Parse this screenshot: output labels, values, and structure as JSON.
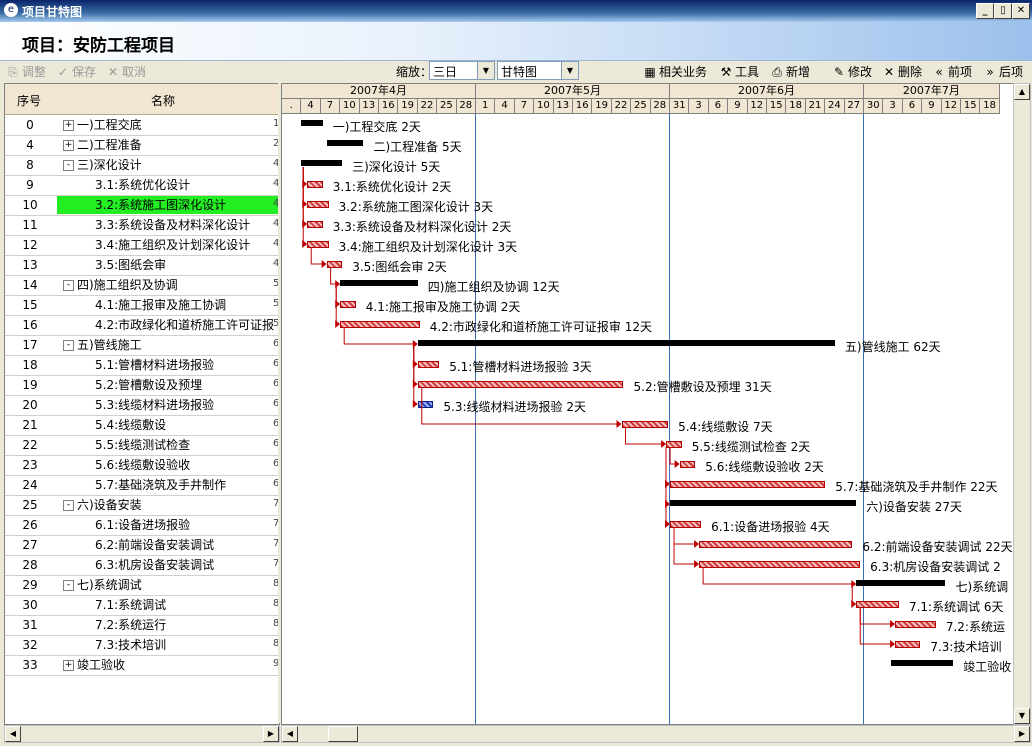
{
  "window": {
    "title": "项目甘特图",
    "minimize": "_",
    "restore": "▯",
    "close": "✕"
  },
  "header": {
    "project_title": "项目：安防工程项目"
  },
  "toolbar": {
    "adjust": "调整",
    "save": "保存",
    "cancel": "取消",
    "zoom_label": "缩放：",
    "zoom_value": "三日",
    "view_value": "甘特图",
    "related": "相关业务",
    "tools": "工具",
    "add": "新增",
    "edit": "修改",
    "delete": "删除",
    "prev": "前项",
    "next": "后项"
  },
  "columns": {
    "seq": "序号",
    "name": "名称"
  },
  "rows": [
    {
      "no": "0",
      "name": "一)工程交底",
      "expander": "+",
      "level": 0,
      "extra": "1"
    },
    {
      "no": "4",
      "name": "二)工程准备",
      "expander": "+",
      "level": 0,
      "extra": "2"
    },
    {
      "no": "8",
      "name": "三)深化设计",
      "expander": "-",
      "level": 0,
      "extra": "4"
    },
    {
      "no": "9",
      "name": "3.1:系统优化设计",
      "expander": "",
      "level": 1,
      "extra": "4"
    },
    {
      "no": "10",
      "name": "3.2:系统施工图深化设计",
      "expander": "",
      "level": 1,
      "extra": "4",
      "selected": true
    },
    {
      "no": "11",
      "name": "3.3:系统设备及材料深化设计",
      "expander": "",
      "level": 1,
      "extra": "4"
    },
    {
      "no": "12",
      "name": "3.4:施工组织及计划深化设计",
      "expander": "",
      "level": 1,
      "extra": "4"
    },
    {
      "no": "13",
      "name": "3.5:图纸会审",
      "expander": "",
      "level": 1,
      "extra": "4"
    },
    {
      "no": "14",
      "name": "四)施工组织及协调",
      "expander": "-",
      "level": 0,
      "extra": "5"
    },
    {
      "no": "15",
      "name": "4.1:施工报审及施工协调",
      "expander": "",
      "level": 1,
      "extra": "5"
    },
    {
      "no": "16",
      "name": "4.2:市政绿化和道桥施工许可证报",
      "expander": "",
      "level": 1,
      "extra": "5"
    },
    {
      "no": "17",
      "name": "五)管线施工",
      "expander": "-",
      "level": 0,
      "extra": "6"
    },
    {
      "no": "18",
      "name": "5.1:管槽材料进场报验",
      "expander": "",
      "level": 1,
      "extra": "6"
    },
    {
      "no": "19",
      "name": "5.2:管槽敷设及预埋",
      "expander": "",
      "level": 1,
      "extra": "6"
    },
    {
      "no": "20",
      "name": "5.3:线缆材料进场报验",
      "expander": "",
      "level": 1,
      "extra": "6"
    },
    {
      "no": "21",
      "name": "5.4:线缆敷设",
      "expander": "",
      "level": 1,
      "extra": "6"
    },
    {
      "no": "22",
      "name": "5.5:线缆测试检查",
      "expander": "",
      "level": 1,
      "extra": "6"
    },
    {
      "no": "23",
      "name": "5.6:线缆敷设验收",
      "expander": "",
      "level": 1,
      "extra": "6"
    },
    {
      "no": "24",
      "name": "5.7:基础浇筑及手井制作",
      "expander": "",
      "level": 1,
      "extra": "6"
    },
    {
      "no": "25",
      "name": "六)设备安装",
      "expander": "-",
      "level": 0,
      "extra": "7"
    },
    {
      "no": "26",
      "name": "6.1:设备进场报验",
      "expander": "",
      "level": 1,
      "extra": "7"
    },
    {
      "no": "27",
      "name": "6.2:前端设备安装调试",
      "expander": "",
      "level": 1,
      "extra": "7"
    },
    {
      "no": "28",
      "name": "6.3:机房设备安装调试",
      "expander": "",
      "level": 1,
      "extra": "7"
    },
    {
      "no": "29",
      "name": "七)系统调试",
      "expander": "-",
      "level": 0,
      "extra": "8"
    },
    {
      "no": "30",
      "name": "7.1:系统调试",
      "expander": "",
      "level": 1,
      "extra": "8"
    },
    {
      "no": "31",
      "name": "7.2:系统运行",
      "expander": "",
      "level": 1,
      "extra": "8"
    },
    {
      "no": "32",
      "name": "7.3:技术培训",
      "expander": "",
      "level": 1,
      "extra": "8"
    },
    {
      "no": "33",
      "name": "竣工验收",
      "expander": "+",
      "level": 0,
      "extra": "9"
    }
  ],
  "timeline": {
    "months": [
      "2007年4月",
      "2007年5月",
      "2007年6月",
      "2007年7月"
    ],
    "days": [
      ".",
      "4",
      "7",
      "10",
      "13",
      "16",
      "19",
      "22",
      "25",
      "28",
      "1",
      "4",
      "7",
      "10",
      "13",
      "16",
      "19",
      "22",
      "25",
      "28",
      "31",
      "3",
      "6",
      "9",
      "12",
      "15",
      "18",
      "21",
      "24",
      "27",
      "30",
      "3",
      "6",
      "9",
      "12",
      "15",
      "18"
    ]
  },
  "bars": [
    {
      "row": 0,
      "type": "summary",
      "start": 1,
      "dur": 1.1,
      "label": "一)工程交底 2天"
    },
    {
      "row": 1,
      "type": "summary",
      "start": 2.3,
      "dur": 1.9,
      "label": "二)工程准备 5天"
    },
    {
      "row": 2,
      "type": "summary",
      "start": 1,
      "dur": 2.1,
      "label": "三)深化设计 5天"
    },
    {
      "row": 3,
      "type": "task",
      "start": 1.3,
      "dur": 0.7,
      "label": "3.1:系统优化设计 2天"
    },
    {
      "row": 4,
      "type": "task",
      "start": 1.3,
      "dur": 1.0,
      "label": "3.2:系统施工图深化设计 3天"
    },
    {
      "row": 5,
      "type": "task",
      "start": 1.3,
      "dur": 0.7,
      "label": "3.3:系统设备及材料深化设计 2天"
    },
    {
      "row": 6,
      "type": "task",
      "start": 1.3,
      "dur": 1.0,
      "label": "3.4:施工组织及计划深化设计 3天"
    },
    {
      "row": 7,
      "type": "task",
      "start": 2.3,
      "dur": 0.7,
      "label": "3.5:图纸会审 2天"
    },
    {
      "row": 8,
      "type": "summary",
      "start": 3.0,
      "dur": 4.0,
      "label": "四)施工组织及协调 12天"
    },
    {
      "row": 9,
      "type": "task",
      "start": 3.0,
      "dur": 0.7,
      "label": "4.1:施工报审及施工协调 2天"
    },
    {
      "row": 10,
      "type": "task",
      "start": 3.0,
      "dur": 4.0,
      "label": "4.2:市政绿化和道桥施工许可证报审 12天"
    },
    {
      "row": 11,
      "type": "summary",
      "start": 7.0,
      "dur": 21.5,
      "label": "五)管线施工 62天"
    },
    {
      "row": 12,
      "type": "task",
      "start": 7.0,
      "dur": 1.0,
      "label": "5.1:管槽材料进场报验 3天"
    },
    {
      "row": 13,
      "type": "task",
      "start": 7.0,
      "dur": 10.5,
      "label": "5.2:管槽敷设及预埋 31天"
    },
    {
      "row": 14,
      "type": "blue",
      "start": 7.0,
      "dur": 0.7,
      "label": "5.3:线缆材料进场报验 2天"
    },
    {
      "row": 15,
      "type": "task",
      "start": 17.5,
      "dur": 2.3,
      "label": "5.4:线缆敷设 7天"
    },
    {
      "row": 16,
      "type": "task",
      "start": 19.8,
      "dur": 0.7,
      "label": "5.5:线缆测试检查 2天"
    },
    {
      "row": 17,
      "type": "task",
      "start": 20.5,
      "dur": 0.7,
      "label": "5.6:线缆敷设验收 2天"
    },
    {
      "row": 18,
      "type": "task",
      "start": 20.0,
      "dur": 7.9,
      "label": "5.7:基础浇筑及手井制作 22天"
    },
    {
      "row": 19,
      "type": "summary",
      "start": 20.0,
      "dur": 9.6,
      "label": "六)设备安装 27天"
    },
    {
      "row": 20,
      "type": "task",
      "start": 20.0,
      "dur": 1.5,
      "label": "6.1:设备进场报验 4天"
    },
    {
      "row": 21,
      "type": "task",
      "start": 21.5,
      "dur": 7.8,
      "label": "6.2:前端设备安装调试 22天"
    },
    {
      "row": 22,
      "type": "task",
      "start": 21.5,
      "dur": 8.2,
      "label": "6.3:机房设备安装调试 2"
    },
    {
      "row": 23,
      "type": "summary",
      "start": 29.6,
      "dur": 4.6,
      "label": "七)系统调"
    },
    {
      "row": 24,
      "type": "task",
      "start": 29.6,
      "dur": 2.1,
      "label": "7.1:系统调试 6天"
    },
    {
      "row": 25,
      "type": "task",
      "start": 31.6,
      "dur": 2.0,
      "label": "7.2:系统运"
    },
    {
      "row": 26,
      "type": "task",
      "start": 31.6,
      "dur": 1.2,
      "label": "7.3:技术培训"
    },
    {
      "row": 27,
      "type": "summary",
      "start": 31.4,
      "dur": 3.2,
      "label": "竣工验收"
    }
  ],
  "connectors": [
    [
      2,
      3
    ],
    [
      2,
      4
    ],
    [
      2,
      5
    ],
    [
      2,
      6
    ],
    [
      6,
      7
    ],
    [
      7,
      8
    ],
    [
      8,
      9
    ],
    [
      8,
      10
    ],
    [
      10,
      11
    ],
    [
      11,
      12
    ],
    [
      11,
      13
    ],
    [
      11,
      14
    ],
    [
      13,
      15
    ],
    [
      15,
      16
    ],
    [
      16,
      17
    ],
    [
      16,
      18
    ],
    [
      18,
      19
    ],
    [
      19,
      20
    ],
    [
      20,
      21
    ],
    [
      20,
      22
    ],
    [
      22,
      23
    ],
    [
      23,
      24
    ],
    [
      24,
      25
    ],
    [
      24,
      26
    ]
  ]
}
